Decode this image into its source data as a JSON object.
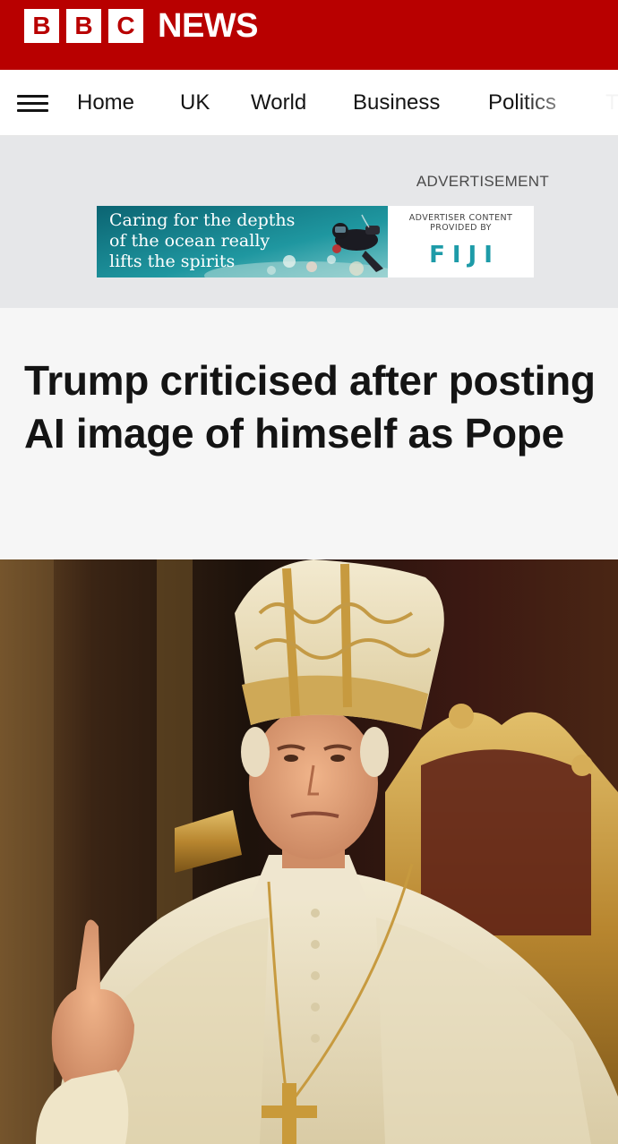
{
  "brand": {
    "logo_letters": [
      "B",
      "B",
      "C"
    ],
    "section": "NEWS",
    "color": "#b80000"
  },
  "nav": {
    "menu_icon": "hamburger-menu-icon",
    "items": [
      {
        "label": "Home"
      },
      {
        "label": "UK"
      },
      {
        "label": "World"
      },
      {
        "label": "Business"
      },
      {
        "label": "Politics"
      },
      {
        "label": "T"
      }
    ]
  },
  "advertisement": {
    "label": "ADVERTISEMENT",
    "banner": {
      "headline_lines": [
        "Caring for the depths",
        "of the ocean really",
        "lifts the spirits"
      ],
      "provided_by_lines": [
        "ADVERTISER CONTENT",
        "PROVIDED BY"
      ],
      "brand": "FIJI"
    }
  },
  "article": {
    "headline": "Trump criticised after posting AI image of himself as Pope"
  }
}
